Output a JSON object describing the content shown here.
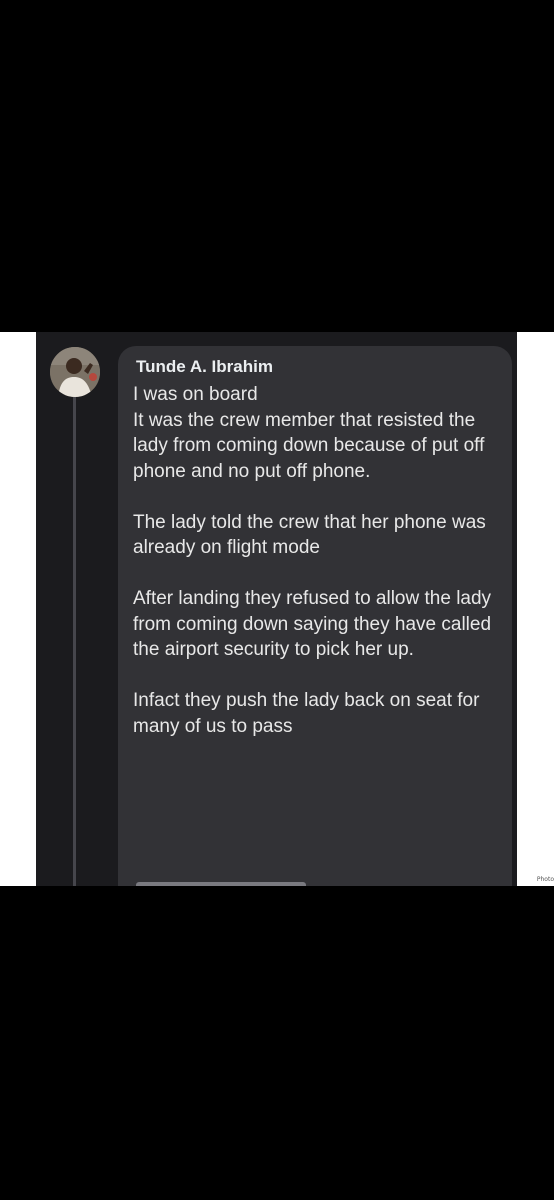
{
  "comment": {
    "author": "Tunde A. Ibrahim",
    "paragraphs": [
      "I was on board\nIt was the crew member that resisted the lady from coming down because of put off phone and no put off phone.",
      "The lady told the crew that her phone was already on flight mode",
      "After landing they refused to allow the lady from coming down saying they have called the airport security to pick her up.",
      "Infact they push the lady back on seat for many of us to pass"
    ]
  },
  "watermark": "Photo",
  "colors": {
    "background": "#000000",
    "frame": "#ffffff",
    "app_background": "#1b1b1e",
    "bubble": "#323236",
    "text": "#e8e8e8"
  },
  "icons": {
    "avatar": "user-profile-photo"
  }
}
